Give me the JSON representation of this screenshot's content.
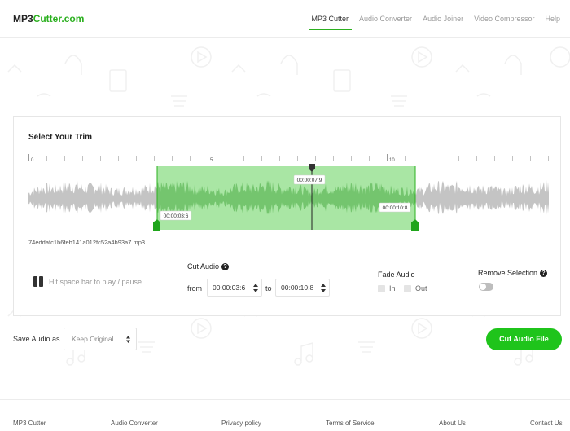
{
  "header": {
    "logo_prefix": "MP3",
    "logo_suffix": "Cutter.com",
    "nav": [
      {
        "label": "MP3 Cutter",
        "active": true
      },
      {
        "label": "Audio Converter",
        "active": false
      },
      {
        "label": "Audio Joiner",
        "active": false
      },
      {
        "label": "Video Compressor",
        "active": false
      },
      {
        "label": "Help",
        "active": false
      }
    ]
  },
  "editor": {
    "title": "Select Your Trim",
    "ruler_labels": [
      "0",
      "5",
      "10"
    ],
    "selection_start_label": "00:00:03:6",
    "selection_end_label": "00:00:10:8",
    "playhead_label": "00:00:07:9",
    "filename": "74eddafc1b6feb141a012fc52a4b93a7.mp3",
    "play_hint": "Hit space bar to play / pause",
    "play_state_icon": "pause-icon",
    "cut_audio": {
      "label": "Cut Audio",
      "help_glyph": "?",
      "from_label": "from",
      "from_value": "00:00:03:6",
      "to_label": "to",
      "to_value": "00:00:10:8"
    },
    "fade": {
      "label": "Fade Audio",
      "in_label": "In",
      "in_checked": false,
      "out_label": "Out",
      "out_checked": false
    },
    "remove_selection": {
      "label": "Remove Selection",
      "help_glyph": "?",
      "enabled": false
    }
  },
  "save": {
    "label": "Save Audio as",
    "format_value": "Keep Original",
    "button_label": "Cut Audio File"
  },
  "footer": {
    "links": [
      "MP3 Cutter",
      "Audio Converter",
      "Privacy policy",
      "Terms of Service",
      "About Us",
      "Contact Us"
    ]
  },
  "colors": {
    "brand": "#2bb01f",
    "button": "#1fc41b",
    "selection": "#a9e6a4",
    "waveform": "#c4c4c4",
    "waveform_selected": "#74c56e"
  }
}
